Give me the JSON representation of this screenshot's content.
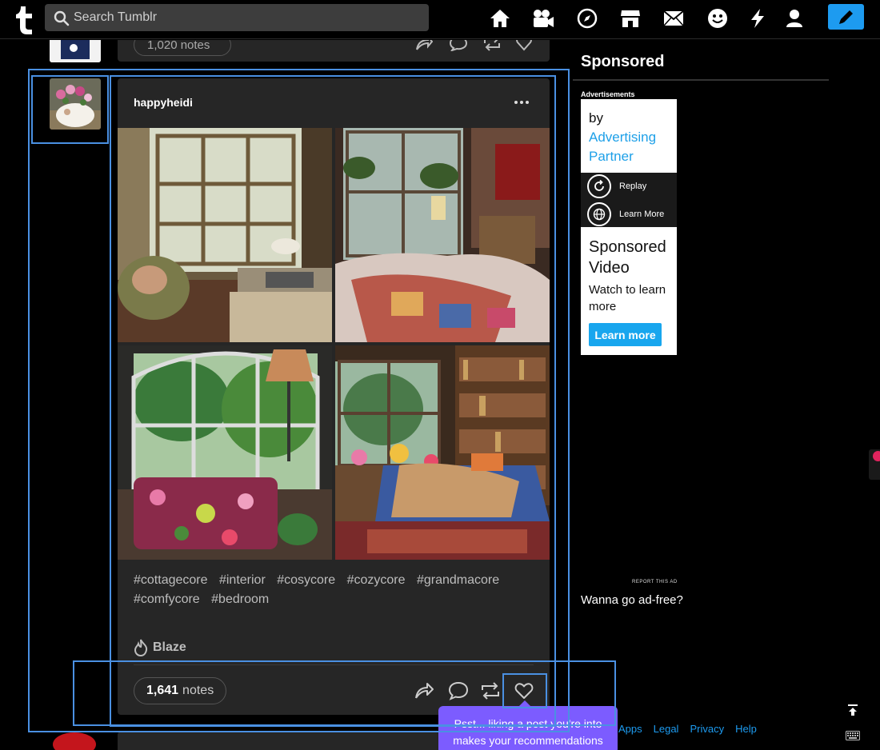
{
  "topbar": {
    "search_placeholder": "Search Tumblr",
    "nav_icons": [
      "home-icon",
      "video-camera-icon",
      "explore-compass-icon",
      "shop-icon",
      "messages-envelope-icon",
      "activity-smiley-icon",
      "lightning-icon",
      "account-person-icon"
    ],
    "compose_icon": "pencil-icon"
  },
  "prev_post": {
    "notes_text": "1,020 notes"
  },
  "post": {
    "username": "happyheidi",
    "photos": [
      "sunny cottage kitchen with armchair and sink",
      "bedroom with patchwork quilt and hanging plants",
      "conservatory with floral sofa and lamp",
      "bedroom with bookshelves and quilted bed"
    ],
    "tags": [
      "#cottagecore",
      "#interior",
      "#cosycore",
      "#cozycore",
      "#grandmacore",
      "#comfycore",
      "#bedroom"
    ],
    "blaze_label": "Blaze",
    "notes_count": "1,641",
    "notes_label": "notes",
    "actions": [
      "share-icon",
      "reply-icon",
      "reblog-icon",
      "like-heart-icon"
    ]
  },
  "sidebar": {
    "title": "Sponsored",
    "ads_label": "Advertisements",
    "ad": {
      "by": "by",
      "partner": "Advertising Partner",
      "replay": "Replay",
      "learn_more_small": "Learn More",
      "headline": "Sponsored Video",
      "sub": "Watch to learn more",
      "cta": "Learn more"
    },
    "report_ad": "REPORT THIS AD",
    "adfree": "Wanna go ad-free?",
    "footer_links": [
      "Apps",
      "Legal",
      "Privacy",
      "Help"
    ]
  },
  "tooltip": {
    "text": "Psst... liking a post you're into makes your recommendations"
  },
  "colors": {
    "background": "#000000",
    "card": "#262626",
    "accent_blue": "#1d9bf0",
    "tooltip_purple": "#7c5cff",
    "highlight": "#4a90e2"
  }
}
